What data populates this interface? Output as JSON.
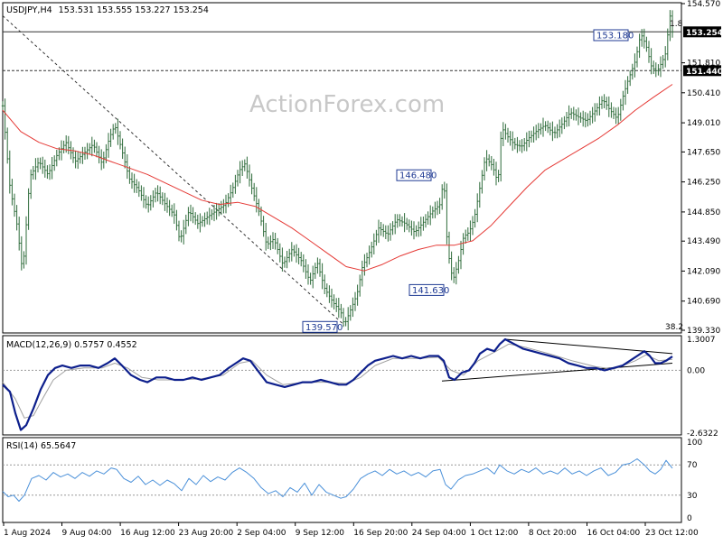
{
  "header": {
    "symbol": "USDJPY,H4",
    "ohlc": "153.531 153.555 153.227 153.254"
  },
  "watermark": "ActionForex.com",
  "colors": {
    "candles": "#2e6b3a",
    "ma": "#e53935",
    "macd": "#0d1f8c",
    "signal": "#a0a0a0",
    "rsi": "#4a90d9",
    "price_tag": "#000000"
  },
  "price_axis": {
    "ticks": [
      "154.570",
      "153.254",
      "151.810",
      "151.440",
      "150.410",
      "149.010",
      "147.650",
      "146.250",
      "144.850",
      "143.490",
      "142.090",
      "140.690",
      "139.330"
    ],
    "current": "153.254",
    "support_level": "151.440"
  },
  "macd": {
    "label": "MACD(12,26,9) 0.5757 0.4552",
    "ticks": [
      "1.3007",
      "0.00",
      "-2.6322"
    ]
  },
  "rsi": {
    "label": "RSI(14) 65.5647",
    "ticks": [
      "100",
      "70",
      "30",
      "0"
    ]
  },
  "annotations": {
    "fib": "38.2",
    "fib_top": "1.8"
  },
  "chart_data": {
    "type": "candlestick",
    "title": "",
    "instrument": "USDJPY",
    "timeframe": "H4",
    "indicators": [
      "MACD(12,26,9)",
      "RSI(14)"
    ],
    "x_labels": [
      "1 Aug 2024",
      "9 Aug 04:00",
      "16 Aug 12:00",
      "23 Aug 20:00",
      "2 Sep 04:00",
      "9 Sep 12:00",
      "16 Sep 20:00",
      "24 Sep 04:00",
      "1 Oct 12:00",
      "8 Oct 20:00",
      "16 Oct 04:00",
      "23 Oct 12:00"
    ],
    "ylim": [
      139.33,
      154.57
    ],
    "close_path": [
      [
        0,
        149.8
      ],
      [
        8,
        146.0
      ],
      [
        16,
        144.2
      ],
      [
        22,
        142.0
      ],
      [
        30,
        146.5
      ],
      [
        40,
        147.2
      ],
      [
        50,
        146.6
      ],
      [
        60,
        147.5
      ],
      [
        70,
        148.1
      ],
      [
        80,
        147.2
      ],
      [
        90,
        147.6
      ],
      [
        100,
        148.0
      ],
      [
        110,
        147.1
      ],
      [
        118,
        148.3
      ],
      [
        124,
        148.9
      ],
      [
        132,
        147.7
      ],
      [
        140,
        146.4
      ],
      [
        150,
        145.9
      ],
      [
        160,
        145.1
      ],
      [
        170,
        145.8
      ],
      [
        180,
        145.2
      ],
      [
        190,
        144.7
      ],
      [
        196,
        143.5
      ],
      [
        206,
        144.9
      ],
      [
        216,
        144.3
      ],
      [
        226,
        144.6
      ],
      [
        236,
        144.9
      ],
      [
        246,
        145.2
      ],
      [
        254,
        145.9
      ],
      [
        262,
        146.8
      ],
      [
        268,
        147.1
      ],
      [
        276,
        145.9
      ],
      [
        284,
        144.8
      ],
      [
        292,
        143.3
      ],
      [
        300,
        143.6
      ],
      [
        310,
        142.4
      ],
      [
        320,
        143.1
      ],
      [
        330,
        142.6
      ],
      [
        340,
        141.6
      ],
      [
        348,
        142.5
      ],
      [
        356,
        141.3
      ],
      [
        366,
        140.6
      ],
      [
        374,
        140.2
      ],
      [
        378,
        139.57
      ],
      [
        386,
        140.4
      ],
      [
        392,
        141.0
      ],
      [
        398,
        142.3
      ],
      [
        404,
        142.8
      ],
      [
        410,
        143.4
      ],
      [
        416,
        144.1
      ],
      [
        426,
        143.8
      ],
      [
        436,
        144.5
      ],
      [
        446,
        144.3
      ],
      [
        456,
        143.9
      ],
      [
        466,
        144.4
      ],
      [
        476,
        144.9
      ],
      [
        484,
        145.2
      ],
      [
        488,
        146.48
      ],
      [
        492,
        143.2
      ],
      [
        498,
        141.63
      ],
      [
        504,
        142.5
      ],
      [
        510,
        143.7
      ],
      [
        516,
        143.9
      ],
      [
        522,
        144.6
      ],
      [
        528,
        146.0
      ],
      [
        534,
        147.4
      ],
      [
        542,
        147.0
      ],
      [
        548,
        146.2
      ],
      [
        552,
        148.8
      ],
      [
        558,
        148.4
      ],
      [
        566,
        148.0
      ],
      [
        574,
        147.9
      ],
      [
        582,
        148.3
      ],
      [
        590,
        148.6
      ],
      [
        600,
        148.9
      ],
      [
        610,
        148.5
      ],
      [
        620,
        149.0
      ],
      [
        628,
        149.5
      ],
      [
        636,
        149.3
      ],
      [
        646,
        149.1
      ],
      [
        656,
        149.6
      ],
      [
        664,
        150.1
      ],
      [
        672,
        149.6
      ],
      [
        680,
        149.2
      ],
      [
        686,
        150.2
      ],
      [
        692,
        151.0
      ],
      [
        700,
        151.9
      ],
      [
        706,
        153.18
      ],
      [
        712,
        152.6
      ],
      [
        718,
        151.6
      ],
      [
        724,
        151.4
      ],
      [
        730,
        151.9
      ],
      [
        734,
        152.3
      ],
      [
        738,
        154.1
      ],
      [
        741,
        153.254
      ]
    ],
    "ma_path": [
      [
        0,
        149.6
      ],
      [
        20,
        148.6
      ],
      [
        40,
        148.1
      ],
      [
        60,
        147.8
      ],
      [
        80,
        147.7
      ],
      [
        100,
        147.5
      ],
      [
        120,
        147.2
      ],
      [
        140,
        146.9
      ],
      [
        160,
        146.6
      ],
      [
        180,
        146.2
      ],
      [
        200,
        145.8
      ],
      [
        220,
        145.4
      ],
      [
        240,
        145.2
      ],
      [
        260,
        145.3
      ],
      [
        280,
        145.1
      ],
      [
        300,
        144.6
      ],
      [
        320,
        144.1
      ],
      [
        340,
        143.5
      ],
      [
        360,
        142.9
      ],
      [
        380,
        142.3
      ],
      [
        400,
        142.1
      ],
      [
        420,
        142.4
      ],
      [
        440,
        142.8
      ],
      [
        460,
        143.1
      ],
      [
        480,
        143.3
      ],
      [
        500,
        143.3
      ],
      [
        520,
        143.5
      ],
      [
        540,
        144.2
      ],
      [
        560,
        145.1
      ],
      [
        580,
        146.0
      ],
      [
        600,
        146.8
      ],
      [
        620,
        147.3
      ],
      [
        640,
        147.8
      ],
      [
        660,
        148.3
      ],
      [
        680,
        148.9
      ],
      [
        700,
        149.6
      ],
      [
        720,
        150.2
      ],
      [
        741,
        150.8
      ]
    ],
    "labels": [
      {
        "text": "153.180",
        "x": 706,
        "y": 153.18
      },
      {
        "text": "146.480",
        "x": 488,
        "y": 146.48
      },
      {
        "text": "141.630",
        "x": 498,
        "y": 141.63
      },
      {
        "text": "139.570",
        "x": 378,
        "y": 139.57
      }
    ],
    "trendline": {
      "from": [
        0,
        154.0
      ],
      "to": [
        378,
        139.57
      ]
    },
    "horizontal_levels": [
      153.254,
      151.44
    ],
    "macd_ylim": [
      -2.6322,
      1.3007
    ],
    "macd_path": [
      [
        0,
        -0.6
      ],
      [
        8,
        -0.9
      ],
      [
        14,
        -1.8
      ],
      [
        20,
        -2.5
      ],
      [
        26,
        -2.3
      ],
      [
        34,
        -1.6
      ],
      [
        42,
        -0.8
      ],
      [
        50,
        -0.2
      ],
      [
        58,
        0.1
      ],
      [
        66,
        0.2
      ],
      [
        76,
        0.1
      ],
      [
        86,
        0.2
      ],
      [
        96,
        0.2
      ],
      [
        106,
        0.1
      ],
      [
        116,
        0.3
      ],
      [
        124,
        0.5
      ],
      [
        132,
        0.2
      ],
      [
        142,
        -0.2
      ],
      [
        152,
        -0.4
      ],
      [
        160,
        -0.5
      ],
      [
        170,
        -0.3
      ],
      [
        180,
        -0.3
      ],
      [
        190,
        -0.4
      ],
      [
        200,
        -0.4
      ],
      [
        210,
        -0.3
      ],
      [
        220,
        -0.4
      ],
      [
        230,
        -0.3
      ],
      [
        240,
        -0.2
      ],
      [
        250,
        0.1
      ],
      [
        258,
        0.3
      ],
      [
        266,
        0.5
      ],
      [
        274,
        0.4
      ],
      [
        282,
        0.0
      ],
      [
        292,
        -0.5
      ],
      [
        302,
        -0.6
      ],
      [
        312,
        -0.7
      ],
      [
        322,
        -0.6
      ],
      [
        332,
        -0.5
      ],
      [
        342,
        -0.5
      ],
      [
        352,
        -0.4
      ],
      [
        362,
        -0.5
      ],
      [
        372,
        -0.6
      ],
      [
        380,
        -0.6
      ],
      [
        388,
        -0.4
      ],
      [
        396,
        -0.1
      ],
      [
        404,
        0.2
      ],
      [
        412,
        0.4
      ],
      [
        422,
        0.5
      ],
      [
        432,
        0.6
      ],
      [
        442,
        0.5
      ],
      [
        452,
        0.6
      ],
      [
        462,
        0.5
      ],
      [
        472,
        0.6
      ],
      [
        482,
        0.6
      ],
      [
        488,
        0.4
      ],
      [
        494,
        -0.3
      ],
      [
        500,
        -0.4
      ],
      [
        508,
        -0.1
      ],
      [
        516,
        0.0
      ],
      [
        522,
        0.3
      ],
      [
        528,
        0.7
      ],
      [
        536,
        0.9
      ],
      [
        544,
        0.8
      ],
      [
        550,
        1.1
      ],
      [
        556,
        1.3
      ],
      [
        566,
        1.1
      ],
      [
        576,
        0.9
      ],
      [
        586,
        0.8
      ],
      [
        596,
        0.7
      ],
      [
        606,
        0.6
      ],
      [
        616,
        0.5
      ],
      [
        626,
        0.3
      ],
      [
        636,
        0.2
      ],
      [
        646,
        0.1
      ],
      [
        656,
        0.1
      ],
      [
        666,
        0.0
      ],
      [
        676,
        0.1
      ],
      [
        686,
        0.2
      ],
      [
        694,
        0.4
      ],
      [
        702,
        0.6
      ],
      [
        710,
        0.8
      ],
      [
        716,
        0.6
      ],
      [
        722,
        0.3
      ],
      [
        728,
        0.3
      ],
      [
        734,
        0.4
      ],
      [
        741,
        0.58
      ]
    ],
    "signal_path": [
      [
        0,
        -0.5
      ],
      [
        14,
        -1.2
      ],
      [
        24,
        -2.0
      ],
      [
        34,
        -1.9
      ],
      [
        44,
        -1.2
      ],
      [
        56,
        -0.4
      ],
      [
        70,
        0.0
      ],
      [
        90,
        0.1
      ],
      [
        110,
        0.1
      ],
      [
        124,
        0.3
      ],
      [
        138,
        0.1
      ],
      [
        154,
        -0.3
      ],
      [
        172,
        -0.4
      ],
      [
        196,
        -0.4
      ],
      [
        220,
        -0.35
      ],
      [
        244,
        -0.2
      ],
      [
        262,
        0.3
      ],
      [
        276,
        0.4
      ],
      [
        292,
        -0.2
      ],
      [
        310,
        -0.6
      ],
      [
        336,
        -0.5
      ],
      [
        360,
        -0.5
      ],
      [
        380,
        -0.55
      ],
      [
        396,
        -0.3
      ],
      [
        412,
        0.2
      ],
      [
        432,
        0.5
      ],
      [
        460,
        0.5
      ],
      [
        482,
        0.55
      ],
      [
        496,
        0.0
      ],
      [
        510,
        -0.2
      ],
      [
        526,
        0.4
      ],
      [
        546,
        0.8
      ],
      [
        560,
        1.1
      ],
      [
        580,
        0.95
      ],
      [
        604,
        0.7
      ],
      [
        630,
        0.4
      ],
      [
        656,
        0.15
      ],
      [
        676,
        0.05
      ],
      [
        700,
        0.4
      ],
      [
        712,
        0.65
      ],
      [
        726,
        0.4
      ],
      [
        741,
        0.46
      ]
    ],
    "macd_trendlines": [
      {
        "from": [
          556,
          1.3
        ],
        "to": [
          741,
          0.7
        ]
      },
      {
        "from": [
          486,
          -0.45
        ],
        "to": [
          741,
          0.3
        ]
      }
    ],
    "rsi_ylim": [
      0,
      100
    ],
    "rsi_path": [
      [
        0,
        35
      ],
      [
        6,
        28
      ],
      [
        12,
        30
      ],
      [
        18,
        22
      ],
      [
        24,
        30
      ],
      [
        32,
        52
      ],
      [
        40,
        56
      ],
      [
        48,
        50
      ],
      [
        56,
        60
      ],
      [
        64,
        54
      ],
      [
        72,
        58
      ],
      [
        80,
        52
      ],
      [
        88,
        60
      ],
      [
        96,
        55
      ],
      [
        104,
        62
      ],
      [
        112,
        58
      ],
      [
        120,
        66
      ],
      [
        126,
        64
      ],
      [
        134,
        52
      ],
      [
        142,
        47
      ],
      [
        150,
        55
      ],
      [
        158,
        44
      ],
      [
        166,
        50
      ],
      [
        174,
        43
      ],
      [
        182,
        50
      ],
      [
        190,
        45
      ],
      [
        198,
        36
      ],
      [
        206,
        52
      ],
      [
        214,
        44
      ],
      [
        222,
        56
      ],
      [
        230,
        48
      ],
      [
        238,
        54
      ],
      [
        246,
        50
      ],
      [
        254,
        60
      ],
      [
        262,
        66
      ],
      [
        270,
        60
      ],
      [
        278,
        52
      ],
      [
        286,
        40
      ],
      [
        294,
        32
      ],
      [
        302,
        36
      ],
      [
        310,
        28
      ],
      [
        318,
        40
      ],
      [
        326,
        34
      ],
      [
        334,
        46
      ],
      [
        342,
        30
      ],
      [
        350,
        44
      ],
      [
        358,
        34
      ],
      [
        366,
        30
      ],
      [
        374,
        26
      ],
      [
        380,
        28
      ],
      [
        388,
        38
      ],
      [
        396,
        52
      ],
      [
        404,
        58
      ],
      [
        412,
        62
      ],
      [
        420,
        56
      ],
      [
        428,
        64
      ],
      [
        436,
        58
      ],
      [
        444,
        62
      ],
      [
        452,
        56
      ],
      [
        460,
        60
      ],
      [
        468,
        54
      ],
      [
        476,
        62
      ],
      [
        484,
        64
      ],
      [
        490,
        44
      ],
      [
        496,
        38
      ],
      [
        504,
        50
      ],
      [
        512,
        56
      ],
      [
        520,
        58
      ],
      [
        528,
        62
      ],
      [
        536,
        66
      ],
      [
        544,
        58
      ],
      [
        550,
        70
      ],
      [
        558,
        62
      ],
      [
        566,
        58
      ],
      [
        574,
        64
      ],
      [
        582,
        60
      ],
      [
        590,
        66
      ],
      [
        598,
        58
      ],
      [
        606,
        62
      ],
      [
        614,
        58
      ],
      [
        622,
        66
      ],
      [
        630,
        58
      ],
      [
        638,
        62
      ],
      [
        646,
        56
      ],
      [
        654,
        62
      ],
      [
        662,
        66
      ],
      [
        670,
        56
      ],
      [
        678,
        60
      ],
      [
        686,
        70
      ],
      [
        694,
        72
      ],
      [
        702,
        78
      ],
      [
        710,
        70
      ],
      [
        716,
        62
      ],
      [
        722,
        58
      ],
      [
        728,
        64
      ],
      [
        734,
        76
      ],
      [
        741,
        65.56
      ]
    ]
  }
}
